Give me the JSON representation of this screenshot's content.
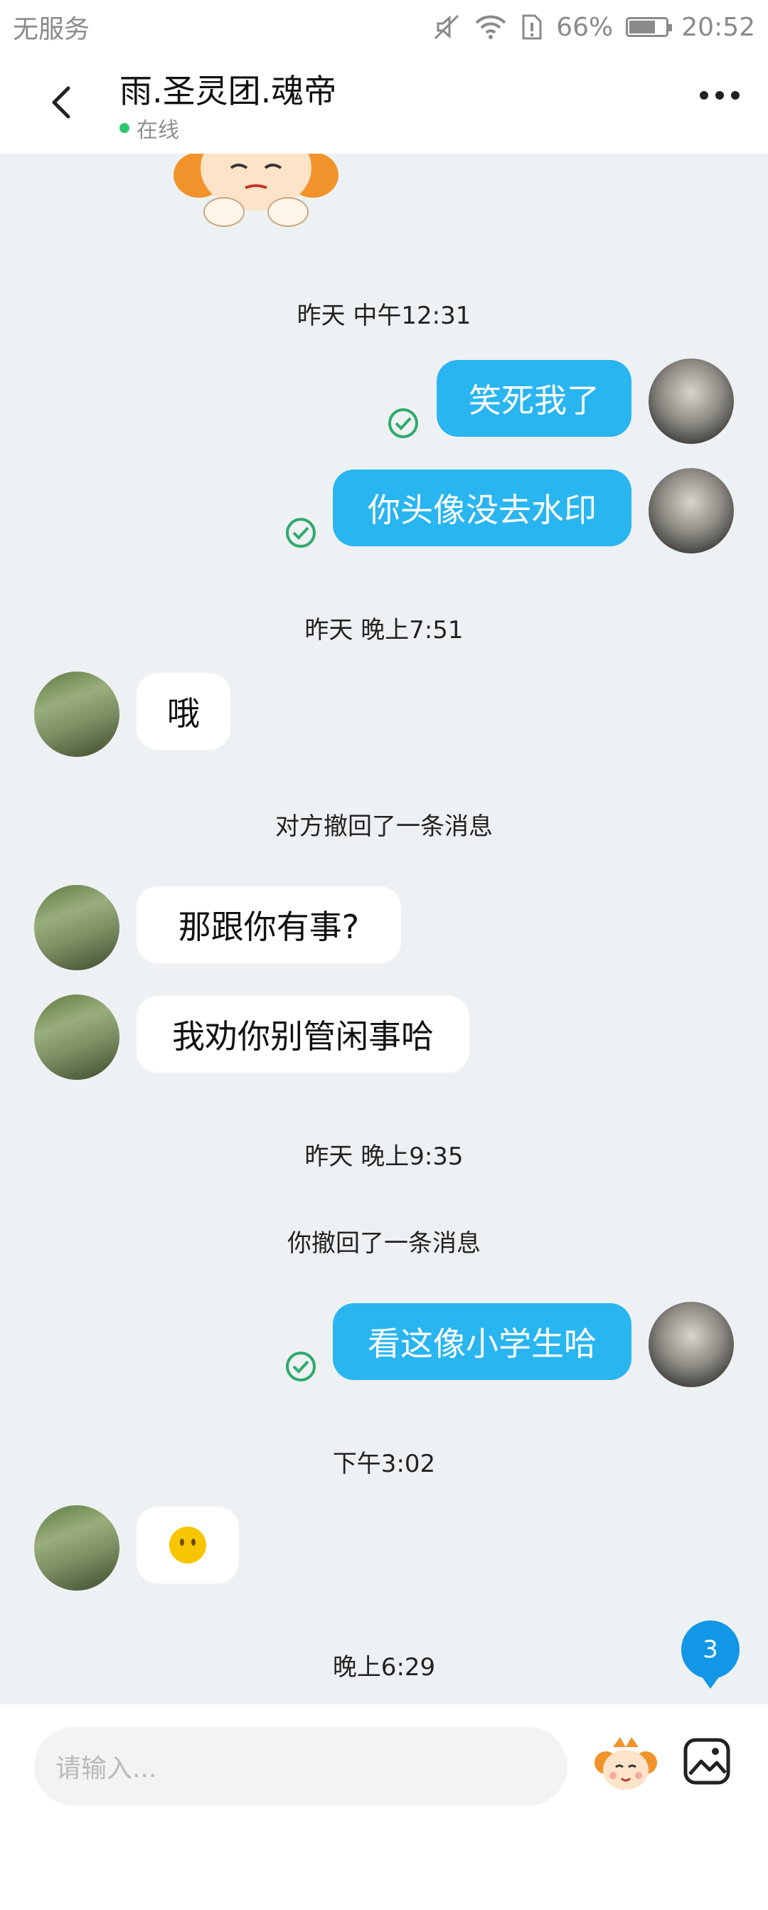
{
  "status_bar": {
    "carrier": "无服务",
    "battery": "66%",
    "time": "20:52"
  },
  "header": {
    "title": "雨.圣灵团.魂帝",
    "status": "在线"
  },
  "messages": {
    "t1": "昨天 中午12:31",
    "m1": "笑死我了",
    "m2": "你头像没去水印",
    "t2": "昨天 晚上7:51",
    "m3": "哦",
    "r1": "对方撤回了一条消息",
    "m4": "那跟你有事?",
    "m5": "我劝你别管闲事哈",
    "t3": "昨天 晚上9:35",
    "r2": "你撤回了一条消息",
    "m6": "看这像小学生哈",
    "t4": "下午3:02",
    "t5": "晚上6:29"
  },
  "unread_count": "3",
  "input": {
    "placeholder": "请输入..."
  },
  "colors": {
    "outgoing_bubble": "#29b5f0",
    "incoming_bubble": "#ffffff",
    "online": "#2ec66f",
    "badge": "#1296e6"
  }
}
